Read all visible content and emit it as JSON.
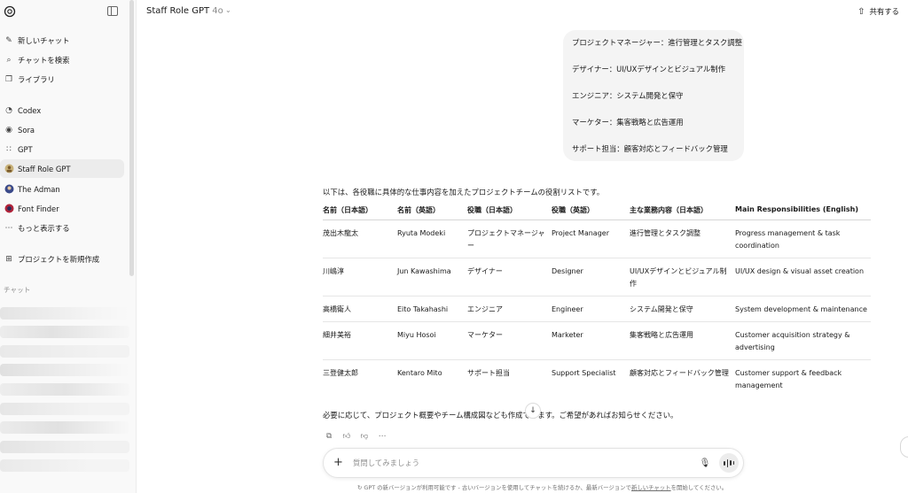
{
  "sidebar": {
    "items": [
      {
        "icon": "edit-icon",
        "label": "新しいチャット"
      },
      {
        "icon": "search-icon",
        "label": "チャットを検索"
      },
      {
        "icon": "library-icon",
        "label": "ライブラリ"
      },
      {
        "icon": "codex-icon",
        "label": "Codex"
      },
      {
        "icon": "sora-icon",
        "label": "Sora"
      },
      {
        "icon": "gpt-grid-icon",
        "label": "GPT"
      },
      {
        "icon": "staff-role-gpt-avatar",
        "label": "Staff Role GPT"
      },
      {
        "icon": "the-adman-avatar",
        "label": "The Adman"
      },
      {
        "icon": "font-finder-avatar",
        "label": "Font Finder"
      },
      {
        "icon": "more-icon",
        "label": "もっと表示する"
      },
      {
        "icon": "new-project-icon",
        "label": "プロジェクトを新規作成"
      }
    ],
    "section_label": "チャット"
  },
  "header": {
    "title": "Staff Role GPT",
    "model": "4o",
    "share_label": "共有する"
  },
  "user_message": [
    "プロジェクトマネージャー：進行管理とタスク調整",
    "デザイナー：UI/UXデザインとビジュアル制作",
    "エンジニア：システム開発と保守",
    "マーケター：集客戦略と広告運用",
    "サポート担当：顧客対応とフィードバック管理"
  ],
  "assistant": {
    "intro": "以下は、各役職に具体的な仕事内容を加えたプロジェクトチームの役割リストです。",
    "table": {
      "headers": [
        "名前（日本語）",
        "名前（英語）",
        "役職（日本語）",
        "役職（英語）",
        "主な業務内容（日本語）",
        "Main Responsibilities (English)"
      ],
      "rows": [
        [
          "茂出木龍太",
          "Ryuta Modeki",
          "プロジェクトマネージャー",
          "Project Manager",
          "進行管理とタスク調整",
          "Progress management & task coordination"
        ],
        [
          "川嶋淳",
          "Jun Kawashima",
          "デザイナー",
          "Designer",
          "UI/UXデザインとビジュアル制作",
          "UI/UX design & visual asset creation"
        ],
        [
          "高橋衛人",
          "Eito Takahashi",
          "エンジニア",
          "Engineer",
          "システム開発と保守",
          "System development & maintenance"
        ],
        [
          "細井美裕",
          "Miyu Hosoi",
          "マーケター",
          "Marketer",
          "集客戦略と広告運用",
          "Customer acquisition strategy & advertising"
        ],
        [
          "三登健太郎",
          "Kentaro Mito",
          "サポート担当",
          "Support Specialist",
          "顧客対応とフィードバック管理",
          "Customer support & feedback management"
        ]
      ]
    },
    "closing": "必要に応じて、プロジェクト概要やチーム構成図なども作成できます。ご希望があればお知らせください。"
  },
  "composer": {
    "placeholder": "質問してみましょう"
  },
  "footer": {
    "text": "GPT の新バージョンが利用可能です - 古いバージョンを使用してチャットを続けるか、最新バージョンで",
    "link": "新しいチャット",
    "text_after": "を開始してください。"
  }
}
